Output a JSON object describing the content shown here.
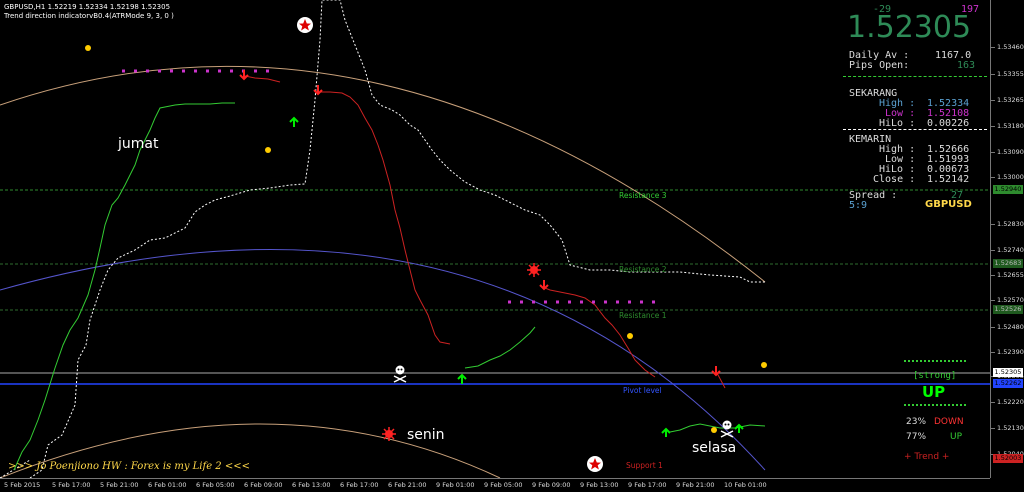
{
  "header": {
    "symbol": "GBPUSD,H1  1.52219 1.52334 1.52198 1.52305",
    "indicator": "Trend direction indicatorvB0.4(ATRMode 9, 3, 0 )"
  },
  "annotations": {
    "jumat": "jumat",
    "senin": "senin",
    "selasa": "selasa",
    "footer": ">>> Jo Poenjiono HW : Forex is my Life 2 <<<"
  },
  "levels": {
    "resistance3": "Resistance 3",
    "resistance2": "Resistance 2",
    "resistance1": "Resistance 1",
    "pivot": "Pivot level",
    "support1": "Support 1"
  },
  "panel": {
    "pips_left": "-29",
    "pips_right": "197",
    "price": "1.52305",
    "daily_av_label": "Daily Av :",
    "daily_av_value": "1167.0",
    "pips_open_label": "Pips Open:",
    "pips_open_value": "163",
    "sekarang": "SEKARANG",
    "high_label": "High :",
    "high_value": "1.52334",
    "low_label": "Low :",
    "low_value": "1.52108",
    "hilo_label": "HiLo :",
    "hilo_value": "0.00226",
    "kemarin": "KEMARIN",
    "k_high_label": "High :",
    "k_high_value": "1.52666",
    "k_low_label": "Low :",
    "k_low_value": "1.51993",
    "k_hilo_label": "HiLo :",
    "k_hilo_value": "0.00673",
    "k_close_label": "Close :",
    "k_close_value": "1.52142",
    "spread_label": "Spread :",
    "spread_value": "27",
    "ratio": "5:9",
    "pair": "GBPUSD"
  },
  "trend": {
    "strong": "[strong]",
    "dir": "UP",
    "down_pct": "23%",
    "down_label": "DOWN",
    "up_pct": "77%",
    "up_label": "UP",
    "trend_label": "+  Trend  +"
  },
  "yaxis": {
    "ticks": [
      "1.53460",
      "1.53355",
      "1.53265",
      "1.53180",
      "1.53090",
      "1.53000",
      "1.52830",
      "1.52740",
      "1.52655",
      "1.52570",
      "1.52480",
      "1.52390",
      "1.52305",
      "1.52220",
      "1.52130",
      "1.52040"
    ],
    "boxes": [
      "1.52940",
      "1.52683",
      "1.52526",
      "1.52305",
      "1.52262",
      "1.52003"
    ]
  },
  "xaxis": {
    "ticks": [
      "5 Feb 2015",
      "5 Feb 17:00",
      "5 Feb 21:00",
      "6 Feb 01:00",
      "6 Feb 05:00",
      "6 Feb 09:00",
      "6 Feb 13:00",
      "6 Feb 17:00",
      "6 Feb 21:00",
      "9 Feb 01:00",
      "9 Feb 05:00",
      "9 Feb 09:00",
      "9 Feb 13:00",
      "9 Feb 17:00",
      "9 Feb 21:00",
      "10 Feb 01:00"
    ]
  },
  "colors": {
    "up": "#00ff00",
    "down": "#ff0000",
    "price": "#2e8b57",
    "magenta": "#cc33cc",
    "gold": "#ffcc00"
  }
}
